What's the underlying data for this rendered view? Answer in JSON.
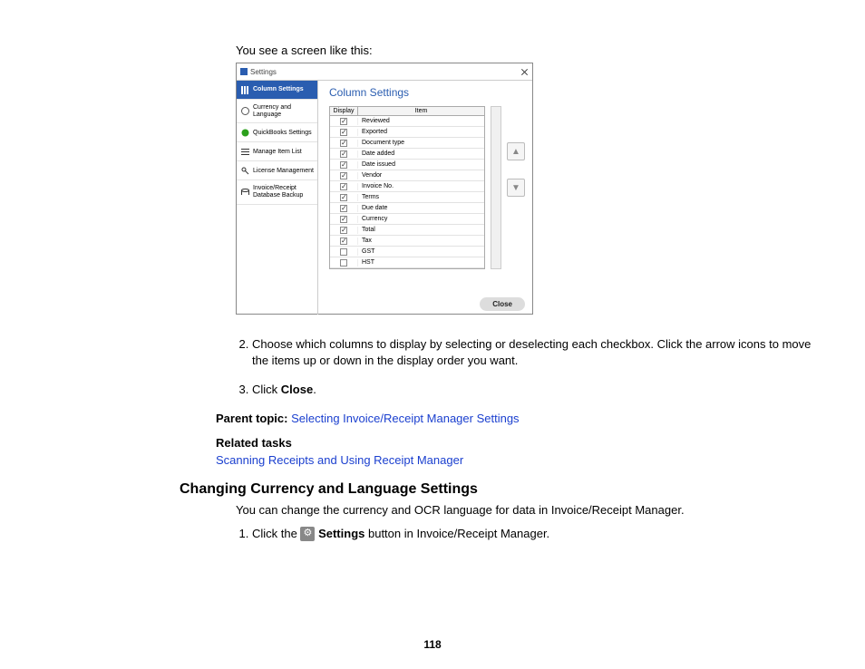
{
  "intro": "You see a screen like this:",
  "dialog": {
    "title": "Settings",
    "close_x": "×",
    "sidebar": [
      {
        "label": "Column Settings",
        "active": true
      },
      {
        "label": "Currency and Language",
        "active": false
      },
      {
        "label": "QuickBooks Settings",
        "active": false
      },
      {
        "label": "Manage Item List",
        "active": false
      },
      {
        "label": "License Management",
        "active": false
      },
      {
        "label": "Invoice/Receipt Database Backup",
        "active": false
      }
    ],
    "panel_title": "Column Settings",
    "columns": {
      "display": "Display",
      "item": "Item"
    },
    "rows": [
      {
        "label": "Reviewed",
        "checked": true
      },
      {
        "label": "Exported",
        "checked": true
      },
      {
        "label": "Document type",
        "checked": true
      },
      {
        "label": "Date added",
        "checked": true
      },
      {
        "label": "Date issued",
        "checked": true
      },
      {
        "label": "Vendor",
        "checked": true
      },
      {
        "label": "Invoice No.",
        "checked": true
      },
      {
        "label": "Terms",
        "checked": true
      },
      {
        "label": "Due date",
        "checked": true
      },
      {
        "label": "Currency",
        "checked": true
      },
      {
        "label": "Total",
        "checked": true
      },
      {
        "label": "Tax",
        "checked": true
      },
      {
        "label": "GST",
        "checked": false
      },
      {
        "label": "HST",
        "checked": false
      }
    ],
    "close_btn": "Close"
  },
  "step2_a": "Choose which columns to display by selecting or deselecting each checkbox. Click the arrow icons to move the items up or down in the display order you want.",
  "step3_a": "Click ",
  "step3_b": "Close",
  "step3_c": ".",
  "parent_label": "Parent topic: ",
  "parent_link": "Selecting Invoice/Receipt Manager Settings",
  "related_label": "Related tasks",
  "related_link": "Scanning Receipts and Using Receipt Manager",
  "h2": "Changing Currency and Language Settings",
  "para2": "You can change the currency and OCR language for data in Invoice/Receipt Manager.",
  "numstep1_a": "Click the ",
  "numstep1_b": " Settings",
  "numstep1_c": " button in Invoice/Receipt Manager.",
  "page_number": "118"
}
